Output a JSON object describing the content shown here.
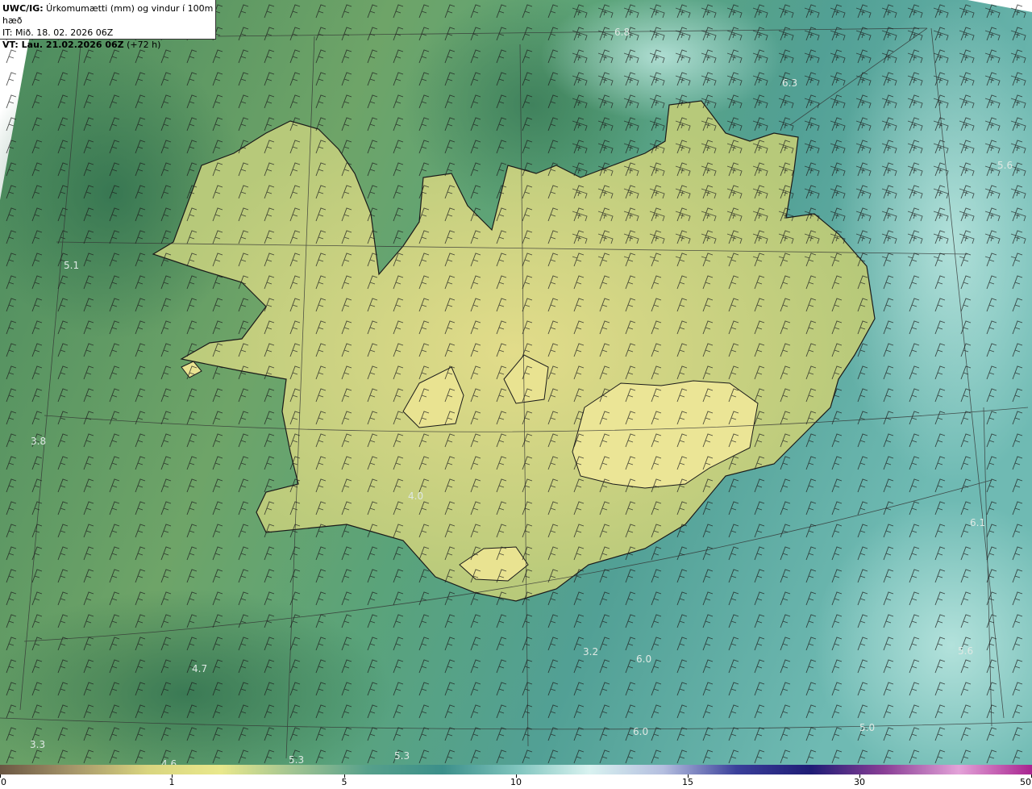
{
  "info": {
    "model": "UWC/IG:",
    "title": " Úrkomumætti (mm) og vindur í 100m hæð",
    "it_line": "IT: Mið. 18. 02. 2026 06Z",
    "vt_label": "VT: Lau. 21.02.2026 06Z",
    "vt_offset": " (+72 h)"
  },
  "map_values": [
    {
      "id": "v1",
      "text": "6.8"
    },
    {
      "id": "v2",
      "text": "6.3"
    },
    {
      "id": "v3",
      "text": "5.6"
    },
    {
      "id": "v4",
      "text": "5.1"
    },
    {
      "id": "v5",
      "text": "3.8"
    },
    {
      "id": "v6",
      "text": "4.0"
    },
    {
      "id": "v7",
      "text": "6.1"
    },
    {
      "id": "v8",
      "text": "3.2"
    },
    {
      "id": "v9",
      "text": "6.0"
    },
    {
      "id": "v10",
      "text": "5.6"
    },
    {
      "id": "v11",
      "text": "4.7"
    },
    {
      "id": "v12",
      "text": "6.0"
    },
    {
      "id": "v13",
      "text": "5.0"
    },
    {
      "id": "v14",
      "text": "3.3"
    },
    {
      "id": "v15",
      "text": "5.3"
    },
    {
      "id": "v16",
      "text": "5.3"
    },
    {
      "id": "v17",
      "text": "4.6"
    }
  ],
  "colorbar": {
    "ticks": [
      "0",
      "1",
      "5",
      "10",
      "15",
      "30",
      "50"
    ],
    "colors": [
      "#6b5743",
      "#a6966a",
      "#d9d57f",
      "#e9e88c",
      "#9fc392",
      "#56a08b",
      "#3c8f8a",
      "#7fc4bd",
      "#d8f2f0",
      "#b4bedf",
      "#3a3f9a",
      "#1f1c75",
      "#8a3f96",
      "#e3a2d8",
      "#a8238f"
    ]
  },
  "colors": {
    "sea_dark": "#3f7f5a",
    "sea_teal": "#4d9c92",
    "land_light": "#d8d88a",
    "land_mid": "#9cbd72"
  }
}
